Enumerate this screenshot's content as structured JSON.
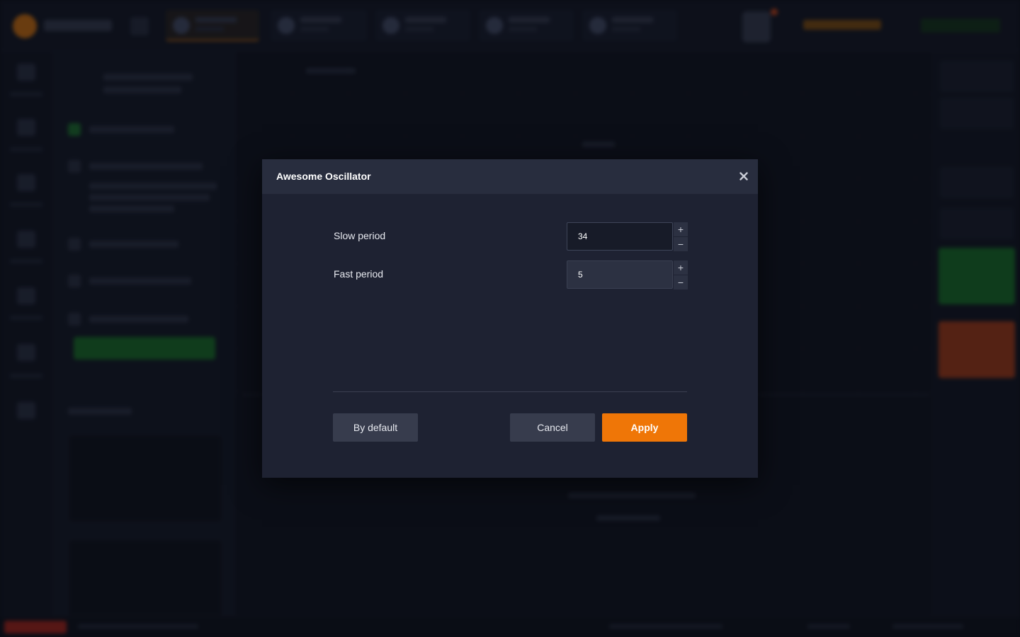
{
  "dialog": {
    "title": "Awesome Oscillator",
    "close_icon": "close-icon",
    "params": [
      {
        "label": "Slow period",
        "value": "34"
      },
      {
        "label": "Fast period",
        "value": "5"
      }
    ],
    "stepper": {
      "plus": "+",
      "minus": "−"
    },
    "buttons": {
      "by_default": "By default",
      "cancel": "Cancel",
      "apply": "Apply"
    }
  },
  "colors": {
    "accent": "#ef7607",
    "dialog_bg": "#1e2232",
    "header_bg": "#282d3e"
  }
}
